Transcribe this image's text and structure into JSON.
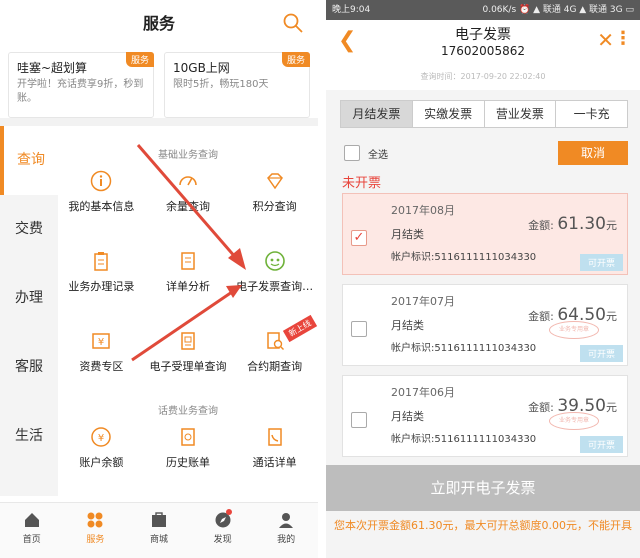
{
  "left": {
    "title": "服务",
    "promos": [
      {
        "title": "哇塞~超划算",
        "sub": "开学啦！充话费享9折，秒到账。",
        "tag": "服务"
      },
      {
        "title": "10GB上网",
        "sub": "限时5折，畅玩180天",
        "tag": "服务"
      }
    ],
    "side": [
      "查询",
      "交费",
      "办理",
      "客服",
      "生活"
    ],
    "sec1": "基础业务查询",
    "sec2": "话费业务查询",
    "rows": [
      [
        {
          "label": "我的基本信息",
          "icon": "info-icon"
        },
        {
          "label": "余量查询",
          "icon": "gauge-icon"
        },
        {
          "label": "积分查询",
          "icon": "diamond-icon"
        }
      ],
      [
        {
          "label": "业务办理记录",
          "icon": "clipboard-icon"
        },
        {
          "label": "详单分析",
          "icon": "document-icon"
        },
        {
          "label": "电子发票查询…",
          "icon": "invoice-icon"
        }
      ],
      [
        {
          "label": "资费专区",
          "icon": "yen-card-icon"
        },
        {
          "label": "电子受理单查询",
          "icon": "receipt-icon"
        },
        {
          "label": "合约期查询",
          "icon": "contract-search-icon"
        }
      ],
      [
        {
          "label": "账户余额",
          "icon": "balance-icon"
        },
        {
          "label": "历史账单",
          "icon": "bill-icon"
        },
        {
          "label": "通话详单",
          "icon": "phone-list-icon"
        }
      ]
    ],
    "new_badge": "新上线",
    "tabbar": [
      {
        "label": "首页",
        "icon": "home-icon"
      },
      {
        "label": "服务",
        "icon": "services-icon"
      },
      {
        "label": "商城",
        "icon": "mall-icon"
      },
      {
        "label": "发现",
        "icon": "compass-icon"
      },
      {
        "label": "我的",
        "icon": "profile-icon"
      }
    ],
    "accent": "#f08a24"
  },
  "right": {
    "status_left": "晚上9:04",
    "status_right": "0.06K/s ⏰ ▲ 联通 4G ▲ 联通 3G ▭",
    "title": "电子发票",
    "phone": "17602005862",
    "sub": "查询时间：2017-09-20 22:02:40",
    "tabs": [
      "月结发票",
      "实缴发票",
      "营业发票",
      "一卡充"
    ],
    "select_all": "全选",
    "cancel": "取消",
    "unbilled": "未开票",
    "cards": [
      {
        "month": "2017年08月",
        "type": "月结类",
        "account": "帐户标识:5116111111034330",
        "amount_label": "金额:",
        "amount": "61.30",
        "unit": "元",
        "status": "可开票",
        "checked": "✓"
      },
      {
        "month": "2017年07月",
        "type": "月结类",
        "account": "帐户标识:5116111111034330",
        "amount_label": "金额:",
        "amount": "64.50",
        "unit": "元",
        "status": "可开票",
        "stamp": "业务专用章"
      },
      {
        "month": "2017年06月",
        "type": "月结类",
        "account": "帐户标识:5116111111034330",
        "amount_label": "金额:",
        "amount": "39.50",
        "unit": "元",
        "status": "可开票",
        "stamp": "业务专用章"
      }
    ],
    "button": "立即开电子发票",
    "note": "您本次开票金额61.30元，最大可开总额度0.00元，不能开具",
    "accent": "#f08a24",
    "alert": "#e8453c"
  }
}
